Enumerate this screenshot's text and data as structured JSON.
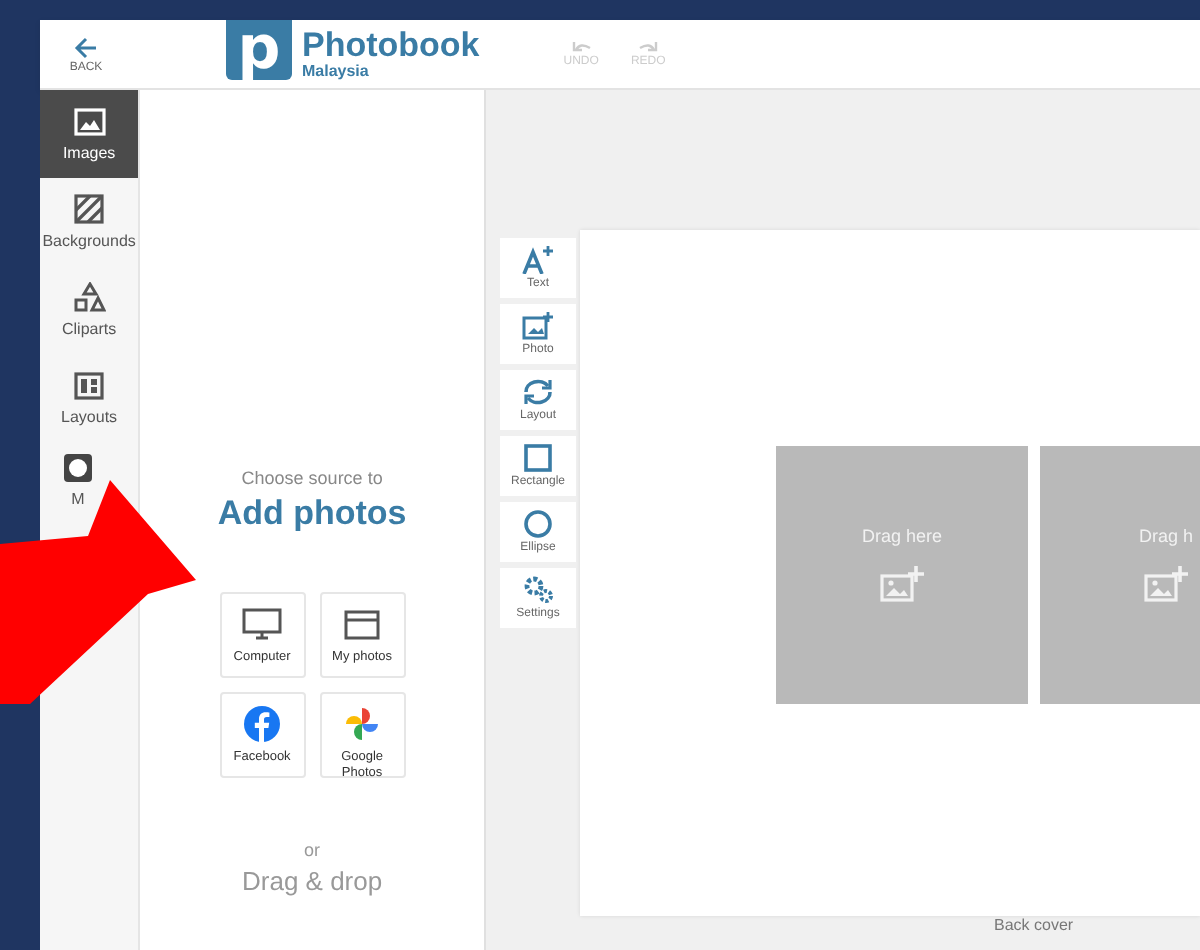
{
  "header": {
    "back": "BACK",
    "logo_mark": "p",
    "brand": "Photobook",
    "brand_sub": "Malaysia",
    "actions": [
      {
        "label": "UNDO",
        "disabled": true
      },
      {
        "label": "REDO",
        "disabled": true
      }
    ]
  },
  "sidebar": {
    "items": [
      {
        "label": "Images",
        "selected": true
      },
      {
        "label": "Backgrounds",
        "selected": false
      },
      {
        "label": "Cliparts",
        "selected": false
      },
      {
        "label": "Layouts",
        "selected": false
      },
      {
        "label": "M",
        "selected": false
      }
    ]
  },
  "panel": {
    "subtitle": "Choose source to",
    "title": "Add photos",
    "sources": [
      {
        "label": "Computer"
      },
      {
        "label": "My photos"
      },
      {
        "label": "Facebook"
      },
      {
        "label": "Google Photos"
      }
    ],
    "or": "or",
    "drop": "Drag & drop"
  },
  "tools": [
    {
      "label": "Text"
    },
    {
      "label": "Photo"
    },
    {
      "label": "Layout"
    },
    {
      "label": "Rectangle"
    },
    {
      "label": "Ellipse"
    },
    {
      "label": "Settings"
    }
  ],
  "slots": [
    {
      "label": "Drag here"
    },
    {
      "label": "Drag h"
    }
  ],
  "page_label": "Back cover"
}
